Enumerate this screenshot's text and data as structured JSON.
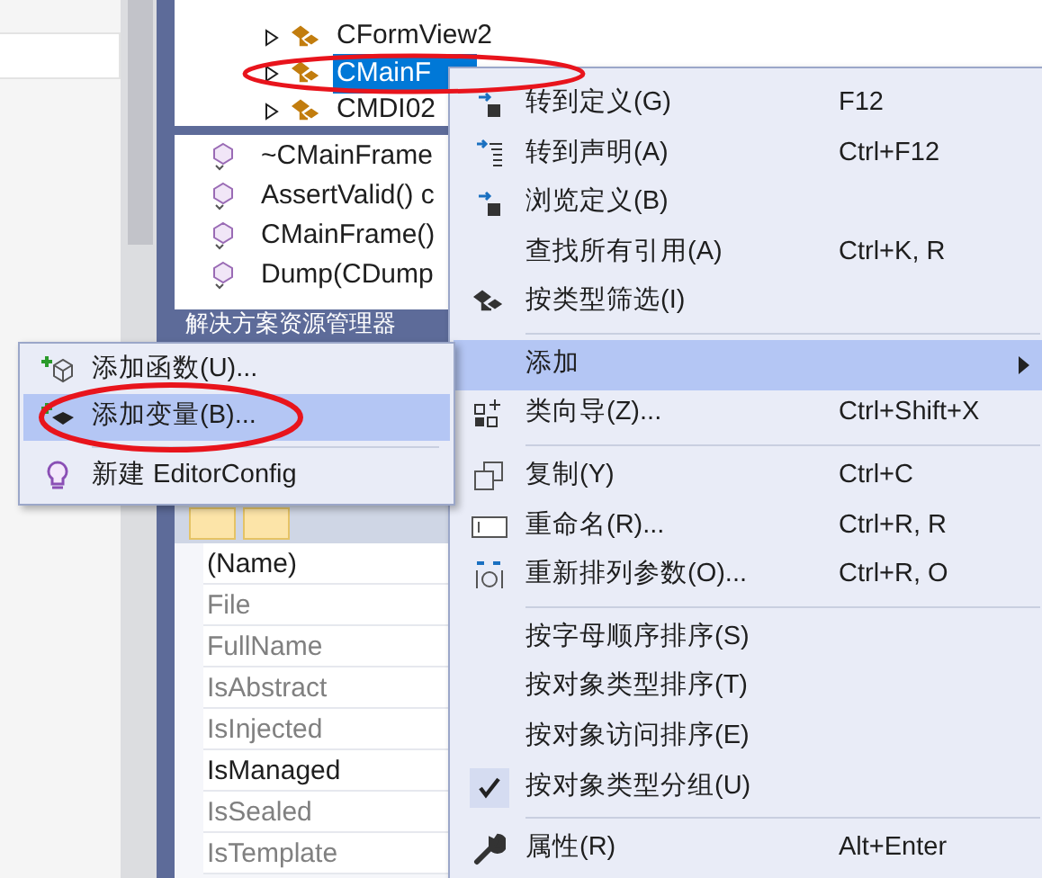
{
  "class_tree": {
    "items": [
      {
        "label": "CFormView2",
        "selected": false
      },
      {
        "label": "CMainF",
        "selected": true
      },
      {
        "label": "CMDI02",
        "selected": false
      }
    ]
  },
  "members": [
    "~CMainFrame",
    "AssertValid() c",
    "CMainFrame()",
    "Dump(CDump"
  ],
  "panel_header": {
    "title": "解决方案资源管理器"
  },
  "properties": [
    {
      "name": "(Name)",
      "dimmed": false
    },
    {
      "name": "File",
      "dimmed": true
    },
    {
      "name": "FullName",
      "dimmed": true
    },
    {
      "name": "IsAbstract",
      "dimmed": true
    },
    {
      "name": "IsInjected",
      "dimmed": true
    },
    {
      "name": "IsManaged",
      "dimmed": false
    },
    {
      "name": "IsSealed",
      "dimmed": true
    },
    {
      "name": "IsTemplate",
      "dimmed": true
    }
  ],
  "context_menu": {
    "items": [
      {
        "kind": "item",
        "label": "转到定义(G)",
        "shortcut": "F12",
        "highlighted": false,
        "checked": false
      },
      {
        "kind": "item",
        "label": "转到声明(A)",
        "shortcut": "Ctrl+F12",
        "highlighted": false,
        "checked": false
      },
      {
        "kind": "item",
        "label": "浏览定义(B)",
        "highlighted": false,
        "checked": false
      },
      {
        "kind": "item",
        "label": "查找所有引用(A)",
        "shortcut": "Ctrl+K, R",
        "highlighted": false,
        "checked": false
      },
      {
        "kind": "item",
        "label": "按类型筛选(I)",
        "highlighted": false,
        "checked": false
      },
      {
        "kind": "separator"
      },
      {
        "kind": "submenu",
        "label": "添加",
        "highlighted": true,
        "checked": false
      },
      {
        "kind": "item",
        "label": "类向导(Z)...",
        "shortcut": "Ctrl+Shift+X",
        "highlighted": false,
        "checked": false
      },
      {
        "kind": "separator"
      },
      {
        "kind": "item",
        "label": "复制(Y)",
        "shortcut": "Ctrl+C",
        "highlighted": false,
        "checked": false
      },
      {
        "kind": "item",
        "label": "重命名(R)...",
        "shortcut": "Ctrl+R, R",
        "highlighted": false,
        "checked": false
      },
      {
        "kind": "item",
        "label": "重新排列参数(O)...",
        "shortcut": "Ctrl+R, O",
        "highlighted": false,
        "checked": false
      },
      {
        "kind": "separator"
      },
      {
        "kind": "item",
        "label": "按字母顺序排序(S)",
        "highlighted": false,
        "checked": false
      },
      {
        "kind": "item",
        "label": "按对象类型排序(T)",
        "highlighted": false,
        "checked": false
      },
      {
        "kind": "item",
        "label": "按对象访问排序(E)",
        "highlighted": false,
        "checked": false
      },
      {
        "kind": "item",
        "label": "按对象类型分组(U)",
        "highlighted": false,
        "checked": true
      },
      {
        "kind": "separator"
      },
      {
        "kind": "item",
        "label": "属性(R)",
        "shortcut": "Alt+Enter",
        "highlighted": false,
        "checked": false
      }
    ]
  },
  "submenu": {
    "items": [
      {
        "kind": "item",
        "label": "添加函数(U)...",
        "highlighted": false
      },
      {
        "kind": "item",
        "label": "添加变量(B)...",
        "highlighted": true
      },
      {
        "kind": "separator"
      },
      {
        "kind": "item",
        "label": "新建 EditorConfig",
        "highlighted": false
      }
    ]
  }
}
